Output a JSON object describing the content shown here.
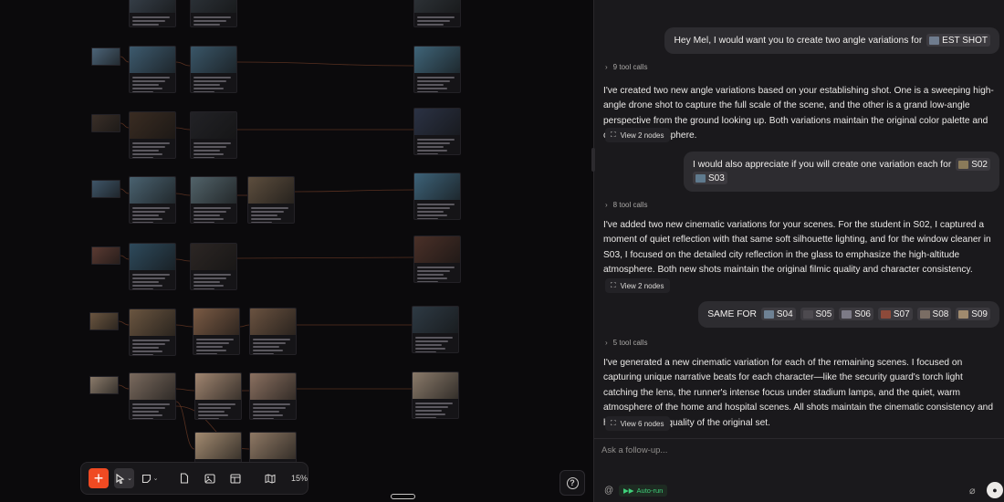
{
  "toolbar": {
    "add_icon": "plus-icon",
    "select_icon": "cursor-arrow-icon",
    "zoom_label": "15%"
  },
  "chat": {
    "messages": [
      {
        "role": "user",
        "text": "Hey Mel, I would want you to create two angle variations for",
        "chips": [
          {
            "label": "EST SHOT",
            "color": "#6f7c8e"
          }
        ]
      },
      {
        "role": "assistant",
        "tool_calls": "9 tool calls",
        "text": "I've created two new angle variations based on your establishing shot. One is a sweeping high-angle drone shot to capture the full scale of the scene, and the other is a grand low-angle perspective from the ground looking up. Both variations maintain the original color palette and cinematic atmosphere.",
        "view_button": "View 2 nodes"
      },
      {
        "role": "user",
        "text": "I would also appreciate if you will create one variation each for",
        "chips": [
          {
            "label": "S02",
            "color": "#8a7a5a"
          },
          {
            "label": "S03",
            "color": "#5f7a8e"
          }
        ]
      },
      {
        "role": "assistant",
        "tool_calls": "8 tool calls",
        "text": "I've added two new cinematic variations for your scenes. For the student in S02, I captured a moment of quiet reflection with that same soft silhouette lighting, and for the window cleaner in S03, I focused on the detailed city reflection in the glass to emphasize the high-altitude atmosphere. Both new shots maintain the original filmic quality and character consistency.",
        "view_button": "View 2 nodes"
      },
      {
        "role": "user",
        "text": "SAME FOR",
        "chips": [
          {
            "label": "S04",
            "color": "#6e8194"
          },
          {
            "label": "S05",
            "color": "#4d4a4f"
          },
          {
            "label": "S06",
            "color": "#7c7a86"
          },
          {
            "label": "S07",
            "color": "#8d4a3a"
          },
          {
            "label": "S08",
            "color": "#7a6d64"
          },
          {
            "label": "S09",
            "color": "#a08a6e"
          }
        ]
      },
      {
        "role": "assistant",
        "tool_calls": "5 tool calls",
        "text": "I've generated a new cinematic variation for each of the remaining scenes. I focused on capturing unique narrative beats for each character—like the security guard's torch light catching the lens, the runner's intense focus under stadium lamps, and the quiet, warm atmosphere of the home and hospital scenes. All shots maintain the cinematic consistency and high-grade film quality of the original set.",
        "view_button": "View 6 nodes"
      }
    ],
    "followup_placeholder": "Ask a follow-up...",
    "autorun_label": "Auto-run"
  }
}
